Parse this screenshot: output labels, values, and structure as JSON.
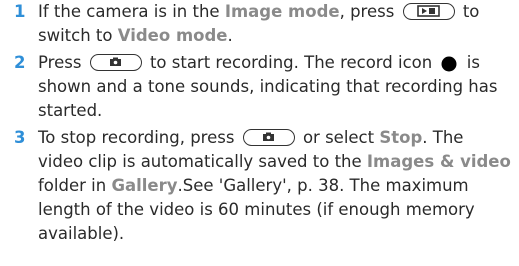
{
  "theme": {
    "accent": "#2f8fd8",
    "highlight": "#8a8a8a"
  },
  "steps": [
    {
      "number": "1",
      "l1a": "If the camera is in the ",
      "l1b": "Image mode",
      "l1c": ", press",
      "l1d": "to",
      "l2a": "switch to ",
      "l2b": "Video mode",
      "l2c": "."
    },
    {
      "number": "2",
      "l1a": "Press",
      "l1b": "to start recording. The record icon",
      "l1c": "is",
      "l2": "shown and a tone sounds, indicating that recording has",
      "l3": "started."
    },
    {
      "number": "3",
      "l1a": "To stop recording, press",
      "l1b": "or select ",
      "l1c": "Stop",
      "l1d": ". The",
      "l2a": "video clip is automatically saved to the ",
      "l2b": "Images & video",
      "l3a": "folder in ",
      "l3b": "Gallery",
      "l3c": ".See 'Gallery', p. 38. The maximum",
      "l4": "length of the video is 60 minutes (if enough memory",
      "l5": "available)."
    }
  ]
}
